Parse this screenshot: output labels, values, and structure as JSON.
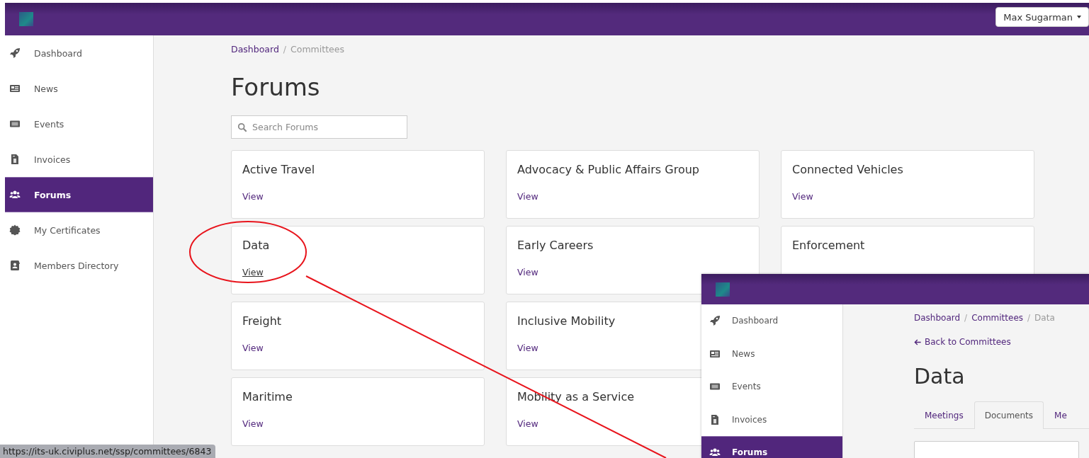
{
  "top_bar": {
    "user_menu": "Max Sugarman"
  },
  "sidebar": {
    "items": [
      {
        "label": "Dashboard",
        "kind": "rocket",
        "selected": false
      },
      {
        "label": "News",
        "kind": "news",
        "selected": false
      },
      {
        "label": "Events",
        "kind": "ticket",
        "selected": false
      },
      {
        "label": "Invoices",
        "kind": "invoice",
        "selected": false
      },
      {
        "label": "Forums",
        "kind": "users",
        "selected": true
      },
      {
        "label": "My Certificates",
        "kind": "certificate",
        "selected": false
      },
      {
        "label": "Members Directory",
        "kind": "contact",
        "selected": false
      }
    ]
  },
  "breadcrumb": {
    "separator": "/",
    "items": [
      {
        "label": "Dashboard",
        "link": true
      },
      {
        "label": "Committees",
        "link": false
      }
    ]
  },
  "page_title": "Forums",
  "search": {
    "placeholder": "Search Forums"
  },
  "forum_rows": [
    [
      {
        "name": "Active Travel",
        "link": "View",
        "hovered": false
      },
      {
        "name": "Advocacy & Public Affairs Group",
        "link": "View",
        "hovered": false
      },
      {
        "name": "Connected Vehicles",
        "link": "View",
        "hovered": false
      }
    ],
    [
      {
        "name": "Data",
        "link": "View",
        "hovered": true
      },
      {
        "name": "Early Careers",
        "link": "View",
        "hovered": false
      },
      {
        "name": "Enforcement"
      }
    ],
    [
      {
        "name": "Freight",
        "link": "View",
        "hovered": false
      },
      {
        "name": "Inclusive Mobility",
        "link": "View",
        "hovered": false
      }
    ],
    [
      {
        "name": "Maritime",
        "link": "View",
        "hovered": false
      },
      {
        "name": "Mobility as a Service",
        "link": "View",
        "hovered": false
      }
    ]
  ],
  "status_url": "https://its-uk.civiplus.net/ssp/committees/6843",
  "inset": {
    "sidebar": {
      "items": [
        {
          "label": "Dashboard",
          "kind": "rocket",
          "selected": false
        },
        {
          "label": "News",
          "kind": "news",
          "selected": false
        },
        {
          "label": "Events",
          "kind": "ticket",
          "selected": false
        },
        {
          "label": "Invoices",
          "kind": "invoice",
          "selected": false
        },
        {
          "label": "Forums",
          "kind": "users",
          "selected": true
        }
      ]
    },
    "breadcrumb": {
      "separator": "/",
      "items": [
        {
          "label": "Dashboard",
          "link": true
        },
        {
          "label": "Committees",
          "link": true
        },
        {
          "label": "Data",
          "link": false
        }
      ]
    },
    "back_link": "Back to Committees",
    "page_title": "Data",
    "tabs": [
      {
        "label": "Meetings",
        "selected": false
      },
      {
        "label": "Documents",
        "selected": true
      },
      {
        "label": "Me",
        "selected": false
      }
    ]
  }
}
